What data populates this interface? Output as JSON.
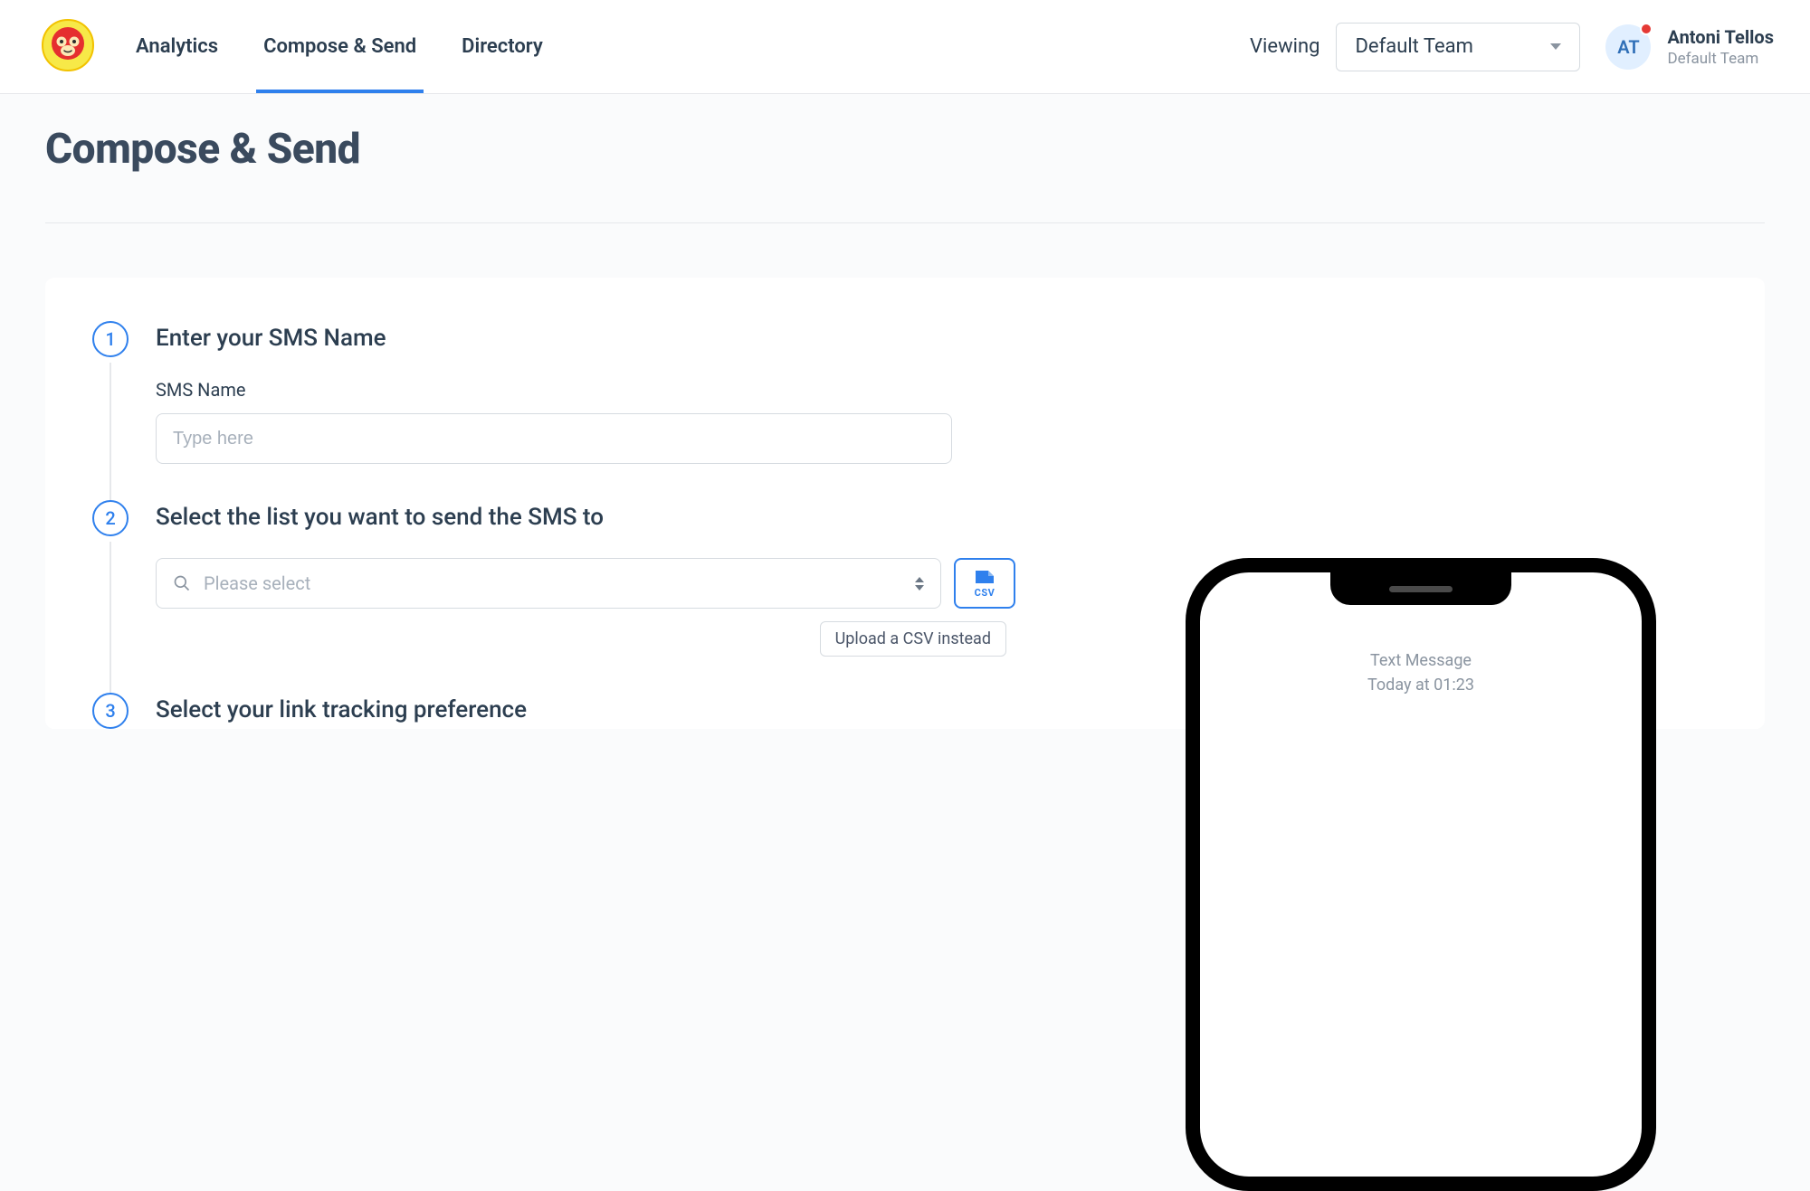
{
  "nav": {
    "items": [
      {
        "label": "Analytics"
      },
      {
        "label": "Compose & Send"
      },
      {
        "label": "Directory"
      }
    ]
  },
  "viewing": {
    "label": "Viewing",
    "team": "Default Team"
  },
  "user": {
    "initials": "AT",
    "name": "Antoni Tellos",
    "team": "Default Team"
  },
  "page": {
    "title": "Compose & Send"
  },
  "steps": {
    "s1": {
      "num": "1",
      "title": "Enter your SMS Name",
      "field_label": "SMS Name",
      "placeholder": "Type here"
    },
    "s2": {
      "num": "2",
      "title": "Select the list you want to send the SMS to",
      "placeholder": "Please select",
      "csv_label": "CSV",
      "upload_hint": "Upload a CSV instead"
    },
    "s3": {
      "num": "3",
      "title": "Select your link tracking preference"
    }
  },
  "phone": {
    "line1": "Text Message",
    "line2": "Today at 01:23"
  }
}
